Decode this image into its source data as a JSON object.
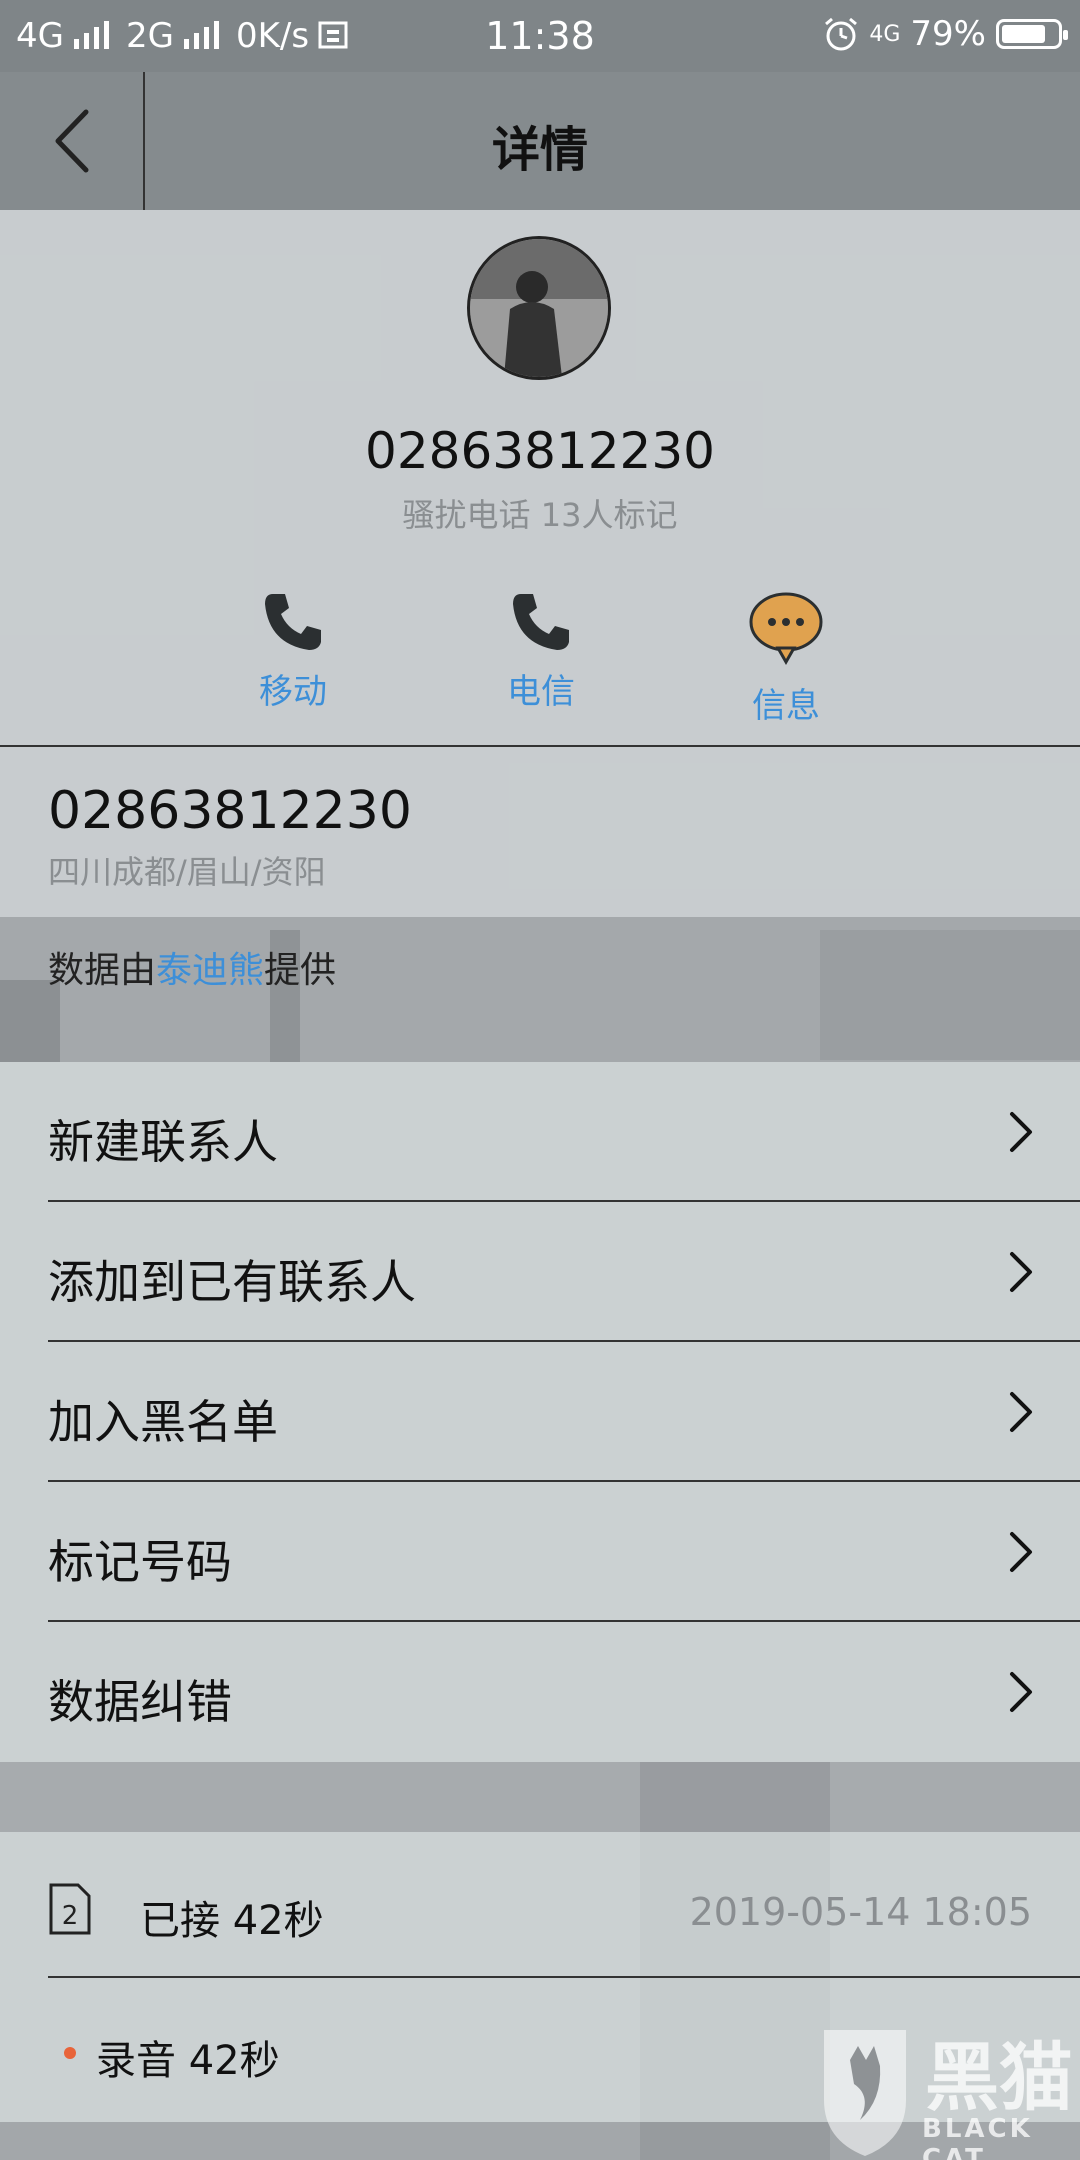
{
  "status_bar": {
    "network_1": "4G",
    "network_2": "2G",
    "speed": "0K/s",
    "time": "11:38",
    "network_3": "4G",
    "battery": "79%",
    "battery_level": 0.79
  },
  "header": {
    "title": "详情"
  },
  "profile": {
    "number": "02863812230",
    "tag": "骚扰电话 13人标记",
    "actions": [
      {
        "label": "移动",
        "icon": "phone-icon"
      },
      {
        "label": "电信",
        "icon": "phone-icon"
      },
      {
        "label": "信息",
        "icon": "message-bubble-icon"
      }
    ]
  },
  "number_info": {
    "number": "02863812230",
    "location": "四川成都/眉山/资阳"
  },
  "provider": {
    "prefix": "数据由",
    "link": "泰迪熊",
    "suffix": "提供"
  },
  "menu": {
    "items": [
      {
        "label": "新建联系人"
      },
      {
        "label": "添加到已有联系人"
      },
      {
        "label": "加入黑名单"
      },
      {
        "label": "标记号码"
      },
      {
        "label": "数据纠错"
      }
    ]
  },
  "call_log": {
    "sim": "2",
    "status": "已接 42秒",
    "time": "2019-05-14 18:05",
    "recording": "录音 42秒"
  },
  "watermark": {
    "text": "黑猫",
    "sub": "BLACK CAT"
  },
  "colors": {
    "accent": "#3d8fd8",
    "header_bg": "#858b8e",
    "message_icon": "#e0a24f",
    "record_dot": "#e8643a"
  }
}
